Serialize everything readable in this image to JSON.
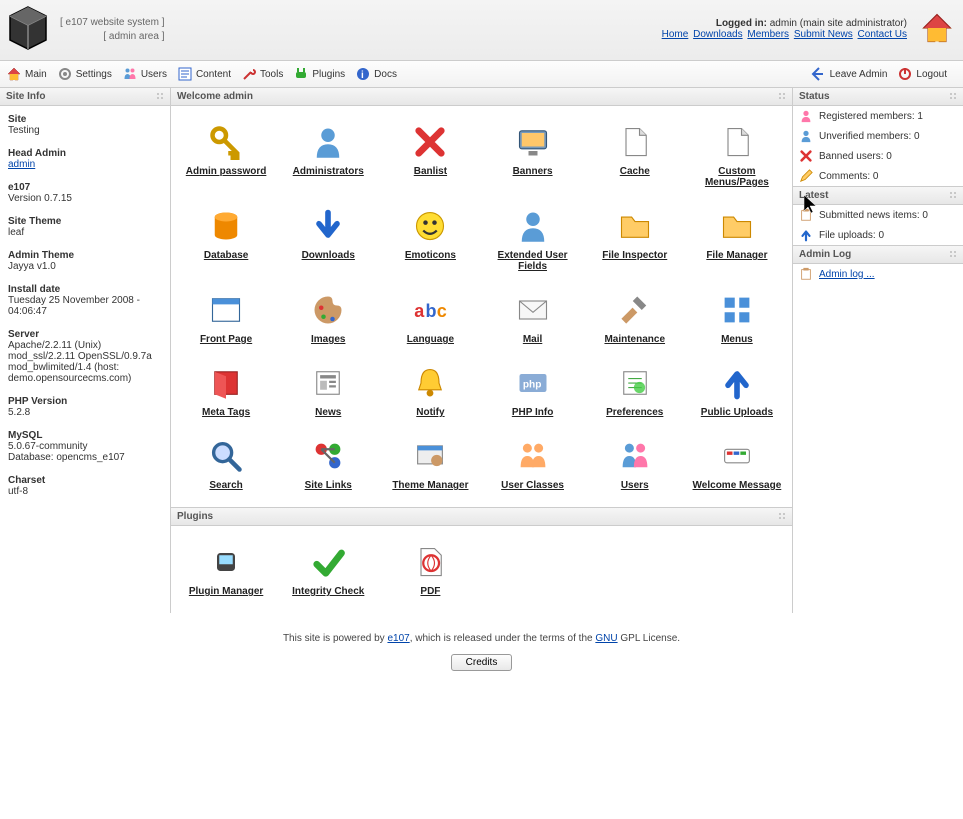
{
  "header": {
    "site_label": "[ e107 website system ]",
    "admin_label": "[ admin area ]",
    "logged_in_label": "Logged in:",
    "logged_in_user": "admin (main site administrator)",
    "nav_links": [
      "Home",
      "Downloads",
      "Members",
      "Submit News",
      "Contact Us"
    ]
  },
  "navbar": {
    "left": [
      "Main",
      "Settings",
      "Users",
      "Content",
      "Tools",
      "Plugins",
      "Docs"
    ],
    "right": [
      "Leave Admin",
      "Logout"
    ]
  },
  "sidebar": {
    "title": "Site Info",
    "items": [
      {
        "label": "Site",
        "value": "Testing"
      },
      {
        "label": "Head Admin",
        "link": "admin"
      },
      {
        "label": "e107",
        "value": "Version 0.7.15"
      },
      {
        "label": "Site Theme",
        "value": "leaf"
      },
      {
        "label": "Admin Theme",
        "value": "Jayya v1.0"
      },
      {
        "label": "Install date",
        "value": "Tuesday 25 November 2008 - 04:06:47"
      },
      {
        "label": "Server",
        "value": "Apache/2.2.11 (Unix) mod_ssl/2.2.11 OpenSSL/0.9.7a mod_bwlimited/1.4 (host: demo.opensourcecms.com)"
      },
      {
        "label": "PHP Version",
        "value": "5.2.8"
      },
      {
        "label": "MySQL",
        "value": "5.0.67-community\nDatabase: opencms_e107"
      },
      {
        "label": "Charset",
        "value": "utf-8"
      }
    ]
  },
  "welcome": {
    "title": "Welcome admin"
  },
  "admin_icons": [
    {
      "name": "admin-password",
      "label": "Admin password",
      "icon": "key-user"
    },
    {
      "name": "administrators",
      "label": "Administrators",
      "icon": "person"
    },
    {
      "name": "banlist",
      "label": "Banlist",
      "icon": "red-x"
    },
    {
      "name": "banners",
      "label": "Banners",
      "icon": "monitor"
    },
    {
      "name": "cache",
      "label": "Cache",
      "icon": "doc-refresh"
    },
    {
      "name": "custom-menus",
      "label": "Custom Menus/Pages",
      "icon": "page-pencil"
    },
    {
      "name": "database",
      "label": "Database",
      "icon": "db"
    },
    {
      "name": "downloads",
      "label": "Downloads",
      "icon": "arrow-down"
    },
    {
      "name": "emoticons",
      "label": "Emoticons",
      "icon": "smile"
    },
    {
      "name": "extended-user-fields",
      "label": "Extended User Fields",
      "icon": "person-plus"
    },
    {
      "name": "file-inspector",
      "label": "File Inspector",
      "icon": "folder-zoom"
    },
    {
      "name": "file-manager",
      "label": "File Manager",
      "icon": "folder"
    },
    {
      "name": "front-page",
      "label": "Front Page",
      "icon": "window"
    },
    {
      "name": "images",
      "label": "Images",
      "icon": "palette"
    },
    {
      "name": "language",
      "label": "Language",
      "icon": "abc"
    },
    {
      "name": "mail",
      "label": "Mail",
      "icon": "mail"
    },
    {
      "name": "maintenance",
      "label": "Maintenance",
      "icon": "hammer"
    },
    {
      "name": "menus",
      "label": "Menus",
      "icon": "grid"
    },
    {
      "name": "meta-tags",
      "label": "Meta Tags",
      "icon": "book"
    },
    {
      "name": "news",
      "label": "News",
      "icon": "news"
    },
    {
      "name": "notify",
      "label": "Notify",
      "icon": "mail-bell"
    },
    {
      "name": "php-info",
      "label": "PHP Info",
      "icon": "php"
    },
    {
      "name": "preferences",
      "label": "Preferences",
      "icon": "pref"
    },
    {
      "name": "public-uploads",
      "label": "Public Uploads",
      "icon": "arrow-up"
    },
    {
      "name": "search",
      "label": "Search",
      "icon": "zoom"
    },
    {
      "name": "site-links",
      "label": "Site Links",
      "icon": "links"
    },
    {
      "name": "theme-manager",
      "label": "Theme Manager",
      "icon": "theme"
    },
    {
      "name": "user-classes",
      "label": "User Classes",
      "icon": "class"
    },
    {
      "name": "users",
      "label": "Users",
      "icon": "users"
    },
    {
      "name": "welcome-message",
      "label": "Welcome Message",
      "icon": "welcome"
    }
  ],
  "plugins_panel": {
    "title": "Plugins",
    "items": [
      {
        "name": "plugin-manager",
        "label": "Plugin Manager",
        "icon": "plug"
      },
      {
        "name": "integrity-check",
        "label": "Integrity Check",
        "icon": "check"
      },
      {
        "name": "pdf",
        "label": "PDF",
        "icon": "pdf"
      }
    ]
  },
  "rightbar": {
    "status": {
      "title": "Status",
      "reg_members": "Registered members: 1",
      "unverified": "Unverified members: 0",
      "banned": "Banned users: 0",
      "comments": "Comments: 0"
    },
    "latest": {
      "title": "Latest",
      "submitted_news": "Submitted news items: 0",
      "file_uploads": "File uploads: 0"
    },
    "admin_log": {
      "title": "Admin Log",
      "link": "Admin log ..."
    }
  },
  "footer": {
    "prefix": "This site is powered by ",
    "link1": "e107",
    "mid": ", which is released under the terms of the ",
    "link2": "GNU",
    "suffix": " GPL License.",
    "credits": "Credits"
  }
}
